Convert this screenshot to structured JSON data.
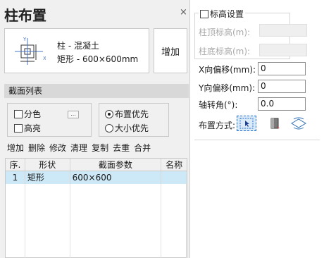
{
  "window": {
    "title": "柱布置",
    "close_glyph": "×"
  },
  "preview": {
    "line1": "柱 - 混凝土",
    "line2": "矩形 - 600×600mm",
    "icon_axis_x": "X",
    "icon_axis_y": "Y"
  },
  "add_button": "增加",
  "section_list": {
    "title": "截面列表",
    "checkbox_color": "分色",
    "checkbox_highlight": "高亮",
    "dots_button": "...",
    "radio_layout_first": "布置优先",
    "radio_size_first": "大小优先",
    "radio_selected": "布置优先"
  },
  "toolbar": [
    "增加",
    "删除",
    "修改",
    "清理",
    "复制",
    "去重",
    "合并"
  ],
  "table": {
    "headers": [
      "序.",
      "形状",
      "截面参数",
      "名称"
    ],
    "rows": [
      {
        "index": "1",
        "shape": "矩形",
        "params": "600×600",
        "name": ""
      }
    ]
  },
  "elevation": {
    "title": "标高设置",
    "top_label": "柱顶标高(m):",
    "bottom_label": "柱底标高(m):"
  },
  "fields": {
    "x_offset_label": "X向偏移(mm):",
    "x_offset_value": "0",
    "y_offset_label": "Y向偏移(mm):",
    "y_offset_value": "0",
    "rotation_label": "轴转角(°):",
    "rotation_value": "0.0"
  },
  "layout_mode": {
    "label": "布置方式:",
    "modes": [
      "point-click-icon",
      "column-cylinder-icon",
      "grid-region-icon"
    ]
  },
  "colors": {
    "selected_row": "#cde8f6",
    "panel_bg": "#f0f0f0",
    "active_accent": "#1f6fd0"
  }
}
